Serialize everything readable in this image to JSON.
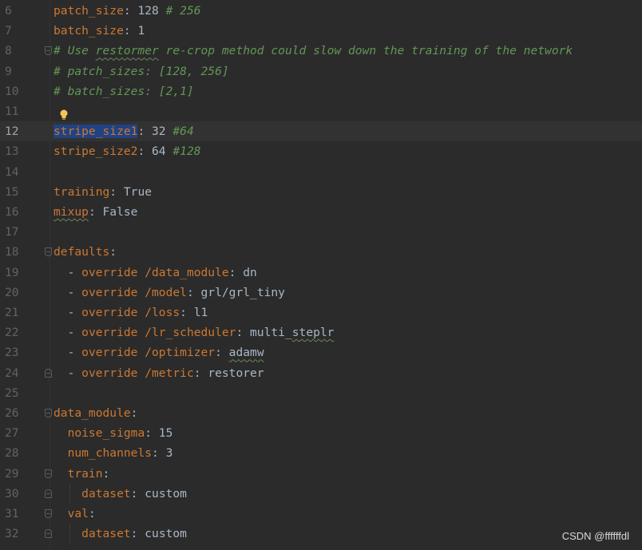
{
  "editor": {
    "lines": [
      {
        "n": "6",
        "parts": [
          {
            "t": "patch_size",
            "c": "key"
          },
          {
            "t": ": 128 ",
            "c": "val"
          },
          {
            "t": "# 256",
            "c": "cm"
          }
        ]
      },
      {
        "n": "7",
        "parts": [
          {
            "t": "batch_size",
            "c": "key"
          },
          {
            "t": ": 1",
            "c": "val"
          }
        ]
      },
      {
        "n": "8",
        "parts": [
          {
            "t": "# Use ",
            "c": "cm"
          },
          {
            "t": "restormer",
            "c": "cm wavy"
          },
          {
            "t": " re-crop method could slow down the training of the network",
            "c": "cm"
          }
        ]
      },
      {
        "n": "9",
        "parts": [
          {
            "t": "# patch_sizes: [128, 256]",
            "c": "cm"
          }
        ]
      },
      {
        "n": "10",
        "parts": [
          {
            "t": "# batch_sizes: [2,1]",
            "c": "cm"
          }
        ]
      },
      {
        "n": "11",
        "parts": []
      },
      {
        "n": "12",
        "parts": [
          {
            "t": "stripe_size1",
            "c": "key sel"
          },
          {
            "t": ": 32 ",
            "c": "val"
          },
          {
            "t": "#64",
            "c": "cm"
          }
        ]
      },
      {
        "n": "13",
        "parts": [
          {
            "t": "stripe_size2",
            "c": "key"
          },
          {
            "t": ": 64 ",
            "c": "val"
          },
          {
            "t": "#128",
            "c": "cm"
          }
        ]
      },
      {
        "n": "14",
        "parts": []
      },
      {
        "n": "15",
        "parts": [
          {
            "t": "training",
            "c": "key"
          },
          {
            "t": ": True",
            "c": "val"
          }
        ]
      },
      {
        "n": "16",
        "parts": [
          {
            "t": "mixup",
            "c": "key wavy"
          },
          {
            "t": ": False",
            "c": "val"
          }
        ]
      },
      {
        "n": "17",
        "parts": []
      },
      {
        "n": "18",
        "parts": [
          {
            "t": "defaults",
            "c": "key"
          },
          {
            "t": ":",
            "c": "val"
          }
        ]
      },
      {
        "n": "19",
        "parts": [
          {
            "t": "  - ",
            "c": "val"
          },
          {
            "t": "override /data_module",
            "c": "key"
          },
          {
            "t": ": dn",
            "c": "val"
          }
        ]
      },
      {
        "n": "20",
        "parts": [
          {
            "t": "  - ",
            "c": "val"
          },
          {
            "t": "override /model",
            "c": "key"
          },
          {
            "t": ": grl/grl_tiny",
            "c": "val"
          }
        ]
      },
      {
        "n": "21",
        "parts": [
          {
            "t": "  - ",
            "c": "val"
          },
          {
            "t": "override /loss",
            "c": "key"
          },
          {
            "t": ": l1",
            "c": "val"
          }
        ]
      },
      {
        "n": "22",
        "parts": [
          {
            "t": "  - ",
            "c": "val"
          },
          {
            "t": "override /lr_scheduler",
            "c": "key"
          },
          {
            "t": ": multi_",
            "c": "val"
          },
          {
            "t": "steplr",
            "c": "val wavy"
          }
        ]
      },
      {
        "n": "23",
        "parts": [
          {
            "t": "  - ",
            "c": "val"
          },
          {
            "t": "override /optimizer",
            "c": "key"
          },
          {
            "t": ": ",
            "c": "val"
          },
          {
            "t": "adamw",
            "c": "val wavy"
          }
        ]
      },
      {
        "n": "24",
        "parts": [
          {
            "t": "  - ",
            "c": "val"
          },
          {
            "t": "override /metric",
            "c": "key"
          },
          {
            "t": ": restorer",
            "c": "val"
          }
        ]
      },
      {
        "n": "25",
        "parts": []
      },
      {
        "n": "26",
        "parts": [
          {
            "t": "data_module",
            "c": "key"
          },
          {
            "t": ":",
            "c": "val"
          }
        ]
      },
      {
        "n": "27",
        "parts": [
          {
            "t": "  ",
            "c": "val"
          },
          {
            "t": "noise_sigma",
            "c": "key"
          },
          {
            "t": ": 15",
            "c": "val"
          }
        ]
      },
      {
        "n": "28",
        "parts": [
          {
            "t": "  ",
            "c": "val"
          },
          {
            "t": "num_channels",
            "c": "key"
          },
          {
            "t": ": 3",
            "c": "val"
          }
        ]
      },
      {
        "n": "29",
        "parts": [
          {
            "t": "  ",
            "c": "val"
          },
          {
            "t": "train",
            "c": "key"
          },
          {
            "t": ":",
            "c": "val"
          }
        ]
      },
      {
        "n": "30",
        "parts": [
          {
            "t": "    ",
            "c": "val"
          },
          {
            "t": "dataset",
            "c": "key"
          },
          {
            "t": ": custom",
            "c": "val"
          }
        ]
      },
      {
        "n": "31",
        "parts": [
          {
            "t": "  ",
            "c": "val"
          },
          {
            "t": "val",
            "c": "key"
          },
          {
            "t": ":",
            "c": "val"
          }
        ]
      },
      {
        "n": "32",
        "parts": [
          {
            "t": "    ",
            "c": "val"
          },
          {
            "t": "dataset",
            "c": "key"
          },
          {
            "t": ": custom",
            "c": "val"
          }
        ]
      }
    ],
    "current_line": "12",
    "fold_markers": [
      {
        "line": "8",
        "dir": "down"
      },
      {
        "line": "18",
        "dir": "down"
      },
      {
        "line": "24",
        "dir": "up"
      },
      {
        "line": "26",
        "dir": "down"
      },
      {
        "line": "29",
        "dir": "down"
      },
      {
        "line": "30",
        "dir": "up"
      },
      {
        "line": "31",
        "dir": "down"
      },
      {
        "line": "32",
        "dir": "up"
      }
    ],
    "bulb_icon": "lightbulb-icon"
  },
  "watermark": "CSDN @ffffffdl",
  "colors": {
    "background": "#2b2b2b",
    "key": "#cc7832",
    "comment": "#629755",
    "text": "#a9b7c6",
    "selection": "#214283"
  }
}
